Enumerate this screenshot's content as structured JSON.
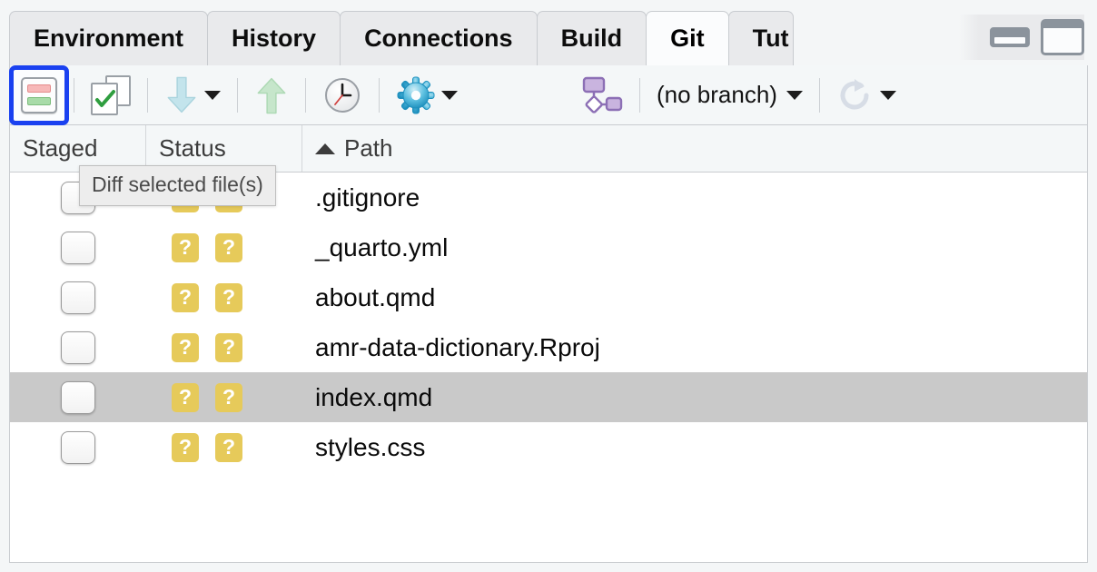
{
  "window": {
    "tabs": [
      {
        "label": "Environment",
        "active": false
      },
      {
        "label": "History",
        "active": false
      },
      {
        "label": "Connections",
        "active": false
      },
      {
        "label": "Build",
        "active": false
      },
      {
        "label": "Git",
        "active": true
      },
      {
        "label": "Tut",
        "active": false,
        "clipped": true
      }
    ],
    "controls": {
      "minimize": "minimize-pane",
      "maximize": "maximize-pane"
    }
  },
  "toolbar": {
    "diff_label": "Diff",
    "commit_label": "Commit",
    "pull_label": "Pull",
    "pull_menu_label": "Pull options",
    "push_label": "Push",
    "history_label": "History",
    "more_label": "More",
    "more_menu_label": "More options",
    "branch_icon_label": "New Branch",
    "branch_name": "(no branch)",
    "branch_menu_label": "Switch branch",
    "refresh_label": "Refresh",
    "refresh_menu_label": "Refresh options"
  },
  "tooltip": {
    "text": "Diff selected file(s)"
  },
  "table": {
    "columns": [
      {
        "key": "staged",
        "label": "Staged"
      },
      {
        "key": "status",
        "label": "Status"
      },
      {
        "key": "path",
        "label": "Path",
        "sort": "ascending"
      }
    ],
    "rows": [
      {
        "staged": false,
        "status_index": "?",
        "status_worktree": "?",
        "path": ".gitignore",
        "selected": false
      },
      {
        "staged": false,
        "status_index": "?",
        "status_worktree": "?",
        "path": "_quarto.yml",
        "selected": false
      },
      {
        "staged": false,
        "status_index": "?",
        "status_worktree": "?",
        "path": "about.qmd",
        "selected": false
      },
      {
        "staged": false,
        "status_index": "?",
        "status_worktree": "?",
        "path": "amr-data-dictionary.Rproj",
        "selected": false
      },
      {
        "staged": false,
        "status_index": "?",
        "status_worktree": "?",
        "path": "index.qmd",
        "selected": true
      },
      {
        "staged": false,
        "status_index": "?",
        "status_worktree": "?",
        "path": "styles.css",
        "selected": false
      }
    ]
  },
  "colors": {
    "focus_ring": "#1a41f0",
    "status_badge": "#e6ca5a",
    "selected_row": "#c9c9c9",
    "diff_removed": "#f7b8b8",
    "diff_added": "#a8dba8",
    "gear": "#49b7df",
    "branch": "#a487c8",
    "pull_arrow": "#bfe3ec",
    "push_arrow": "#bfe4c4"
  }
}
